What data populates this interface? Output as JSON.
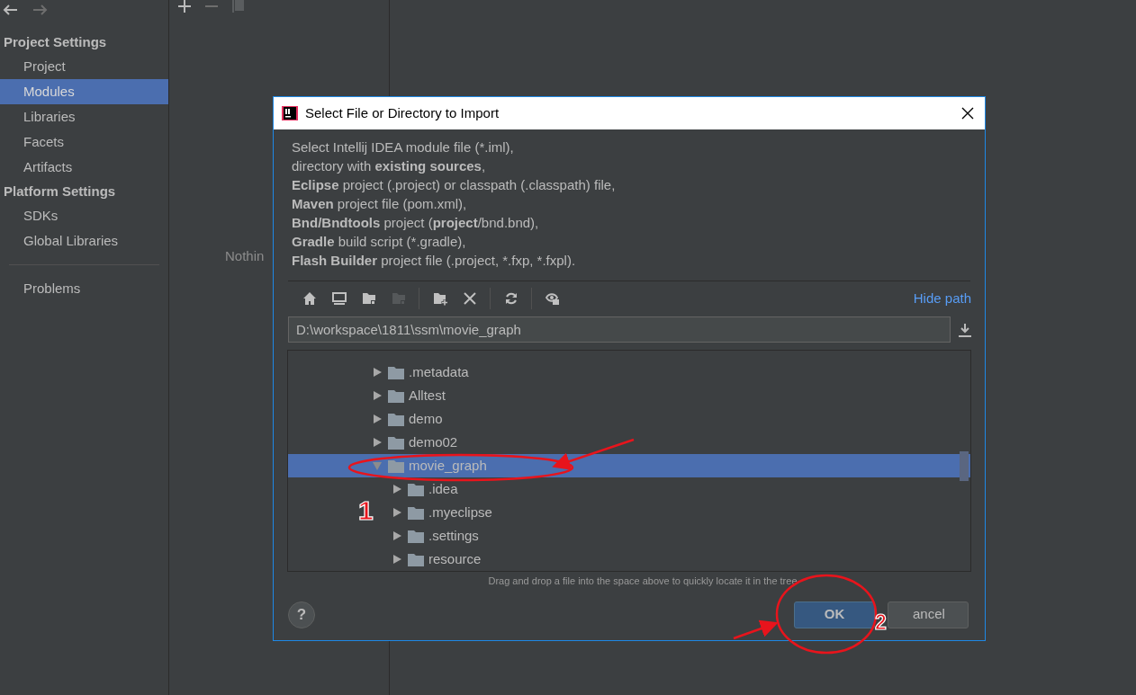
{
  "sidebar": {
    "sections": [
      {
        "title": "Project Settings",
        "items": [
          {
            "label": "Project",
            "selected": false
          },
          {
            "label": "Modules",
            "selected": true
          },
          {
            "label": "Libraries",
            "selected": false
          },
          {
            "label": "Facets",
            "selected": false
          },
          {
            "label": "Artifacts",
            "selected": false
          }
        ]
      },
      {
        "title": "Platform Settings",
        "items": [
          {
            "label": "SDKs",
            "selected": false
          },
          {
            "label": "Global Libraries",
            "selected": false
          }
        ]
      },
      {
        "items": [
          {
            "label": "Problems",
            "selected": false
          }
        ]
      }
    ]
  },
  "middle": {
    "empty_text": "Nothin"
  },
  "dialog": {
    "title": "Select File or Directory to Import",
    "description": [
      "Select Intellij IDEA module file (*.iml),",
      "directory with **existing sources**,",
      "**Eclipse** project (.project) or classpath (.classpath) file,",
      "**Maven** project file (pom.xml),",
      "**Bnd/Bndtools** project (**project**/bnd.bnd),",
      "**Gradle** build script (*.gradle),",
      "**Flash Builder** project file (.project, *.fxp, *.fxpl)."
    ],
    "toolbar": [
      {
        "kind": "home",
        "disabled": false
      },
      {
        "kind": "desktop",
        "disabled": false
      },
      {
        "kind": "module",
        "disabled": false
      },
      {
        "kind": "module",
        "disabled": true
      },
      {
        "kind": "new-folder",
        "disabled": false
      },
      {
        "kind": "delete",
        "disabled": false
      },
      {
        "kind": "refresh",
        "disabled": false
      },
      {
        "kind": "hidden",
        "disabled": false
      }
    ],
    "hide_path": "Hide path",
    "path": "D:\\workspace\\1811\\ssm\\movie_graph",
    "tree": [
      {
        "label": ".metadata",
        "expanded": false,
        "selected": false
      },
      {
        "label": "Alltest",
        "expanded": false,
        "selected": false
      },
      {
        "label": "demo",
        "expanded": false,
        "selected": false
      },
      {
        "label": "demo02",
        "expanded": false,
        "selected": false
      },
      {
        "label": "movie_graph",
        "expanded": true,
        "selected": true,
        "children": [
          {
            "label": ".idea",
            "expanded": false,
            "selected": false
          },
          {
            "label": ".myeclipse",
            "expanded": false,
            "selected": false
          },
          {
            "label": ".settings",
            "expanded": false,
            "selected": false
          },
          {
            "label": "resource",
            "expanded": false,
            "selected": false
          }
        ]
      }
    ],
    "hint": "Drag and drop a file into the space above to quickly locate it in the tree",
    "help": "?",
    "buttons": [
      {
        "label": "OK",
        "kind": "primary"
      },
      {
        "label": "ancel",
        "kind": "secondary"
      }
    ]
  },
  "annotations": [
    {
      "label": "1"
    },
    {
      "label": "2"
    }
  ]
}
